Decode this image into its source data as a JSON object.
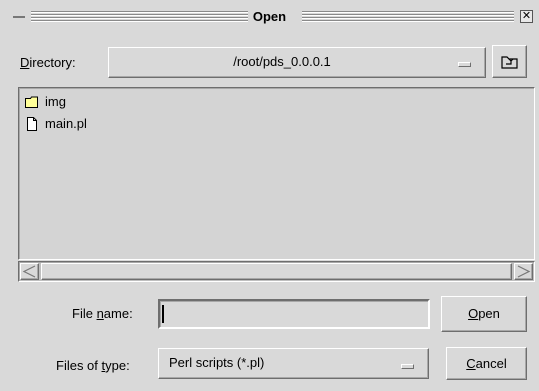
{
  "window": {
    "title": "Open"
  },
  "directory": {
    "label_pre": "",
    "label_u": "D",
    "label_post": "irectory:",
    "value": "/root/pds_0.0.0.1"
  },
  "files": [
    {
      "name": "img",
      "icon": "folder-icon"
    },
    {
      "name": "main.pl",
      "icon": "file-icon"
    }
  ],
  "filename": {
    "label_pre": "File ",
    "label_u": "n",
    "label_post": "ame:",
    "value": ""
  },
  "filetype": {
    "label_pre": "Files of ",
    "label_u": "t",
    "label_post": "ype:",
    "value": "Perl scripts (*.pl)"
  },
  "buttons": {
    "open_u": "O",
    "open_rest": "pen",
    "cancel_u": "C",
    "cancel_rest": "ancel"
  },
  "colors": {
    "background": "#d9d9d9",
    "folder": "#ffff99"
  }
}
